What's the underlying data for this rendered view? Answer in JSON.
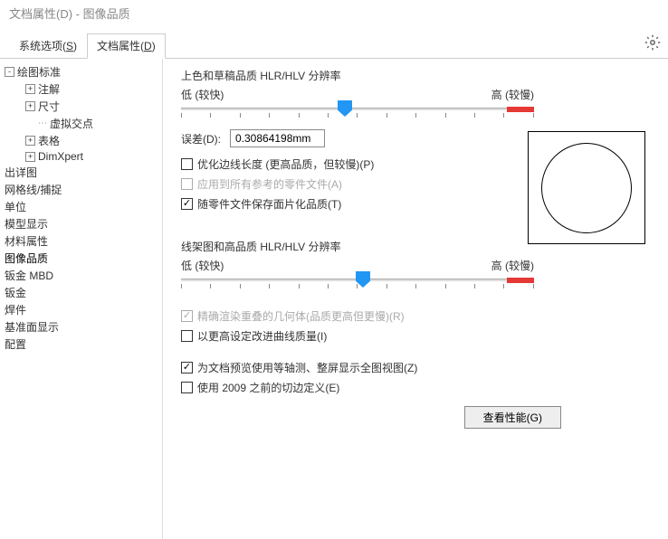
{
  "title": "文档属性(D) - 图像品质",
  "tabs": {
    "system": {
      "label": "系统选项",
      "key": "S"
    },
    "doc": {
      "label": "文档属性",
      "key": "D"
    }
  },
  "tree": [
    {
      "label": "绘图标准",
      "level": 0,
      "expander": "-"
    },
    {
      "label": "注解",
      "level": 1,
      "expander": "+"
    },
    {
      "label": "尺寸",
      "level": 1,
      "expander": "+"
    },
    {
      "label": "虚拟交点",
      "level": 2
    },
    {
      "label": "表格",
      "level": 1,
      "expander": "+"
    },
    {
      "label": "DimXpert",
      "level": 1,
      "expander": "+"
    },
    {
      "label": "出详图",
      "level": 0
    },
    {
      "label": "网格线/捕捉",
      "level": 0
    },
    {
      "label": "单位",
      "level": 0
    },
    {
      "label": "模型显示",
      "level": 0
    },
    {
      "label": "材料属性",
      "level": 0
    },
    {
      "label": "图像品质",
      "level": 0,
      "selected": true
    },
    {
      "label": "钣金 MBD",
      "level": 0
    },
    {
      "label": "钣金",
      "level": 0
    },
    {
      "label": "焊件",
      "level": 0
    },
    {
      "label": "基准面显示",
      "level": 0
    },
    {
      "label": "配置",
      "level": 0
    }
  ],
  "section1": {
    "title": "上色和草稿品质 HLR/HLV 分辨率",
    "low": "低 (较快)",
    "high": "高 (较慢)",
    "deviation_label": "误差(D):",
    "deviation_value": "0.30864198mm",
    "optimize": "优化边线长度 (更高品质，但较慢)(P)",
    "apply_all": "应用到所有参考的零件文件(A)",
    "save_tess": "随零件文件保存面片化品质(T)"
  },
  "section2": {
    "title": "线架图和高品质 HLR/HLV 分辨率",
    "low": "低 (较快)",
    "high": "高 (较慢)",
    "precise": "精确渲染重叠的几何体(品质更高但更慢)(R)",
    "improve": "以更高设定改进曲线质量(I)"
  },
  "bottom": {
    "isometric": "为文档预览使用等轴测、整屏显示全图视图(Z)",
    "legacy": "使用 2009 之前的切边定义(E)",
    "perf_btn": "查看性能(G)"
  }
}
